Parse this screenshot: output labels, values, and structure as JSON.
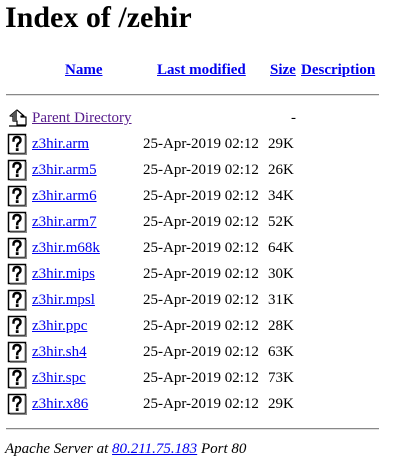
{
  "page": {
    "title": "Index of /zehir"
  },
  "columns": {
    "name": "Name",
    "last_modified": "Last modified",
    "size": "Size",
    "description": "Description"
  },
  "parent": {
    "label": "Parent Directory",
    "size": "-",
    "icon": "back-icon"
  },
  "files": [
    {
      "name": "z3hir.arm",
      "date": "25-Apr-2019 02:12",
      "size": "29K",
      "icon": "unknown-file-icon"
    },
    {
      "name": "z3hir.arm5",
      "date": "25-Apr-2019 02:12",
      "size": "26K",
      "icon": "unknown-file-icon"
    },
    {
      "name": "z3hir.arm6",
      "date": "25-Apr-2019 02:12",
      "size": "34K",
      "icon": "unknown-file-icon"
    },
    {
      "name": "z3hir.arm7",
      "date": "25-Apr-2019 02:12",
      "size": "52K",
      "icon": "unknown-file-icon"
    },
    {
      "name": "z3hir.m68k",
      "date": "25-Apr-2019 02:12",
      "size": "64K",
      "icon": "unknown-file-icon"
    },
    {
      "name": "z3hir.mips",
      "date": "25-Apr-2019 02:12",
      "size": "30K",
      "icon": "unknown-file-icon"
    },
    {
      "name": "z3hir.mpsl",
      "date": "25-Apr-2019 02:12",
      "size": "31K",
      "icon": "unknown-file-icon"
    },
    {
      "name": "z3hir.ppc",
      "date": "25-Apr-2019 02:12",
      "size": "28K",
      "icon": "unknown-file-icon"
    },
    {
      "name": "z3hir.sh4",
      "date": "25-Apr-2019 02:12",
      "size": "63K",
      "icon": "unknown-file-icon"
    },
    {
      "name": "z3hir.spc",
      "date": "25-Apr-2019 02:12",
      "size": "73K",
      "icon": "unknown-file-icon"
    },
    {
      "name": "z3hir.x86",
      "date": "25-Apr-2019 02:12",
      "size": "29K",
      "icon": "unknown-file-icon"
    }
  ],
  "footer": {
    "prefix": "Apache Server at ",
    "host": "80.211.75.183",
    "suffix": " Port 80"
  },
  "colors": {
    "link": "#0000ee",
    "visited_link": "#551a8b",
    "text": "#000000"
  }
}
